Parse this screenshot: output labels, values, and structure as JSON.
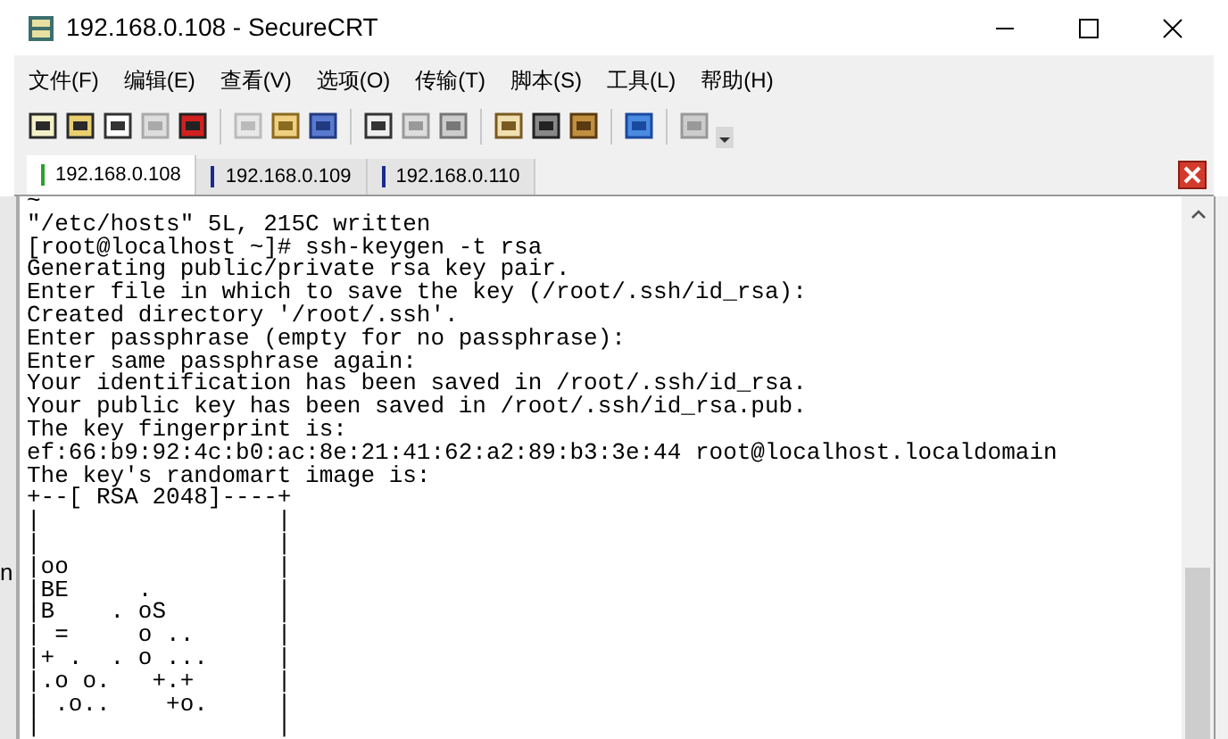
{
  "window": {
    "title": "192.168.0.108 - SecureCRT"
  },
  "menu": [
    "文件(F)",
    "编辑(E)",
    "查看(V)",
    "选项(O)",
    "传输(T)",
    "脚本(S)",
    "工具(L)",
    "帮助(H)"
  ],
  "tabs": [
    {
      "label": "192.168.0.108",
      "selected": true
    },
    {
      "label": "192.168.0.109",
      "selected": false
    },
    {
      "label": "192.168.0.110",
      "selected": false
    }
  ],
  "background_window": {
    "text": "n"
  },
  "terminal": {
    "lines": [
      "~",
      "\"/etc/hosts\" 5L, 215C written",
      "[root@localhost ~]# ssh-keygen -t rsa",
      "Generating public/private rsa key pair.",
      "Enter file in which to save the key (/root/.ssh/id_rsa):",
      "Created directory '/root/.ssh'.",
      "Enter passphrase (empty for no passphrase):",
      "Enter same passphrase again:",
      "Your identification has been saved in /root/.ssh/id_rsa.",
      "Your public key has been saved in /root/.ssh/id_rsa.pub.",
      "The key fingerprint is:",
      "ef:66:b9:92:4c:b0:ac:8e:21:41:62:a2:89:b3:3e:44 root@localhost.localdomain",
      "The key's randomart image is:",
      "+--[ RSA 2048]----+",
      "|                 |",
      "|                 |",
      "|oo               |",
      "|BE     .         |",
      "|B    . oS        |",
      "| =     o ..      |",
      "|+ .  . o ...     |",
      "|.o o.   +.+      |",
      "| .o..    +o.     |",
      "|                 |"
    ]
  }
}
